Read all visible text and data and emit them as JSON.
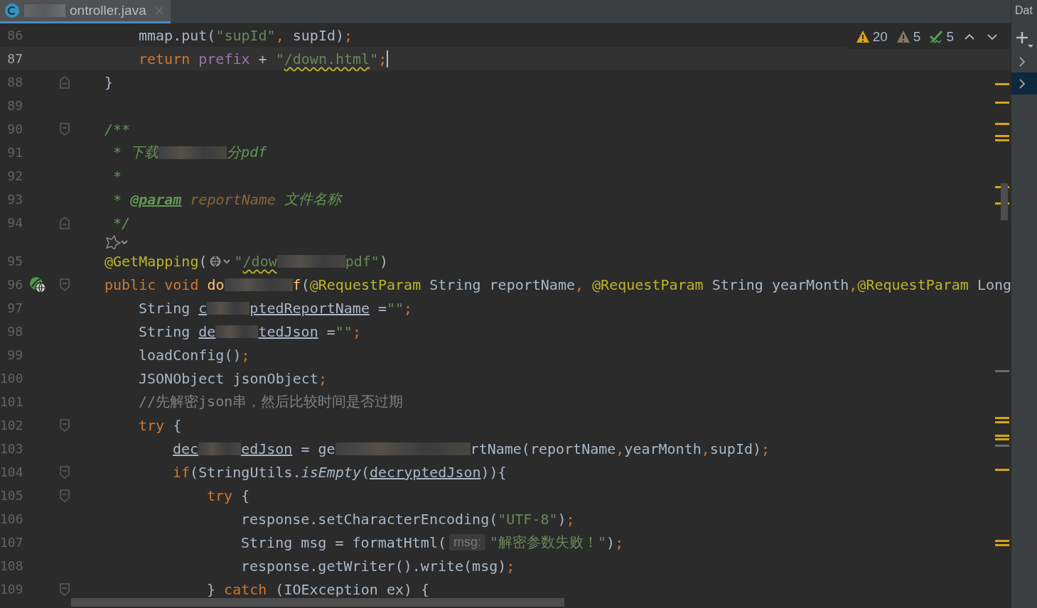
{
  "tab": {
    "file_name": "ontroller.java",
    "selected": true
  },
  "inspections": [
    {
      "kind": "warning",
      "count": "20"
    },
    {
      "kind": "weak_warning",
      "count": "5"
    },
    {
      "kind": "typo",
      "count": "5"
    }
  ],
  "lines": [
    {
      "kind": "code",
      "number": "86",
      "current": false,
      "tokens": [
        {
          "kind": "indent_2"
        },
        {
          "kind": "plain",
          "text": "mmap.put("
        },
        {
          "kind": "string",
          "text": "\"supId\""
        },
        {
          "kind": "punct",
          "text": ","
        },
        {
          "kind": "plain",
          "text": " supId)"
        },
        {
          "kind": "punct",
          "text": ";"
        }
      ]
    },
    {
      "kind": "code",
      "number": "87",
      "current": true,
      "tokens": [
        {
          "kind": "indent_2"
        },
        {
          "kind": "keyword",
          "text": "return"
        },
        {
          "kind": "field",
          "text": " prefix"
        },
        {
          "kind": "plain",
          "text": " + "
        },
        {
          "kind": "string",
          "text": "\""
        },
        {
          "kind": "string_warn",
          "text": "/down.html"
        },
        {
          "kind": "string",
          "text": "\""
        },
        {
          "kind": "punct",
          "text": ";"
        },
        {
          "kind": "caret"
        }
      ]
    },
    {
      "kind": "code",
      "number": "88",
      "current": false,
      "gutter": [
        {
          "kind": "fold_end"
        }
      ],
      "tokens": [
        {
          "kind": "indent_1"
        },
        {
          "kind": "plain",
          "text": "}"
        }
      ]
    },
    {
      "kind": "code",
      "number": "89",
      "current": false
    },
    {
      "kind": "code",
      "number": "90",
      "current": false,
      "gutter": [
        {
          "kind": "fold_start"
        }
      ],
      "tokens": [
        {
          "kind": "indent_1"
        },
        {
          "kind": "doc",
          "text": "/**"
        }
      ]
    },
    {
      "kind": "code",
      "number": "91",
      "current": false,
      "tokens": [
        {
          "kind": "indent_1"
        },
        {
          "kind": "doc",
          "text": " * 下载"
        },
        {
          "kind": "redacted_l"
        },
        {
          "kind": "doc",
          "text": "分pdf"
        }
      ]
    },
    {
      "kind": "code",
      "number": "92",
      "current": false,
      "tokens": [
        {
          "kind": "indent_1"
        },
        {
          "kind": "doc",
          "text": " *"
        }
      ]
    },
    {
      "kind": "code",
      "number": "93",
      "current": false,
      "tokens": [
        {
          "kind": "indent_1"
        },
        {
          "kind": "doc",
          "text": " * "
        },
        {
          "kind": "doc_tag",
          "text": "@param"
        },
        {
          "kind": "doc_param",
          "text": " reportName"
        },
        {
          "kind": "doc",
          "text": " 文件名称"
        }
      ]
    },
    {
      "kind": "code",
      "number": "94",
      "current": false,
      "gutter": [
        {
          "kind": "fold_end"
        }
      ],
      "tokens": [
        {
          "kind": "indent_1"
        },
        {
          "kind": "doc",
          "text": " */"
        }
      ]
    },
    {
      "kind": "inlay"
    },
    {
      "kind": "code",
      "number": "95",
      "current": false,
      "tokens": [
        {
          "kind": "indent_1"
        },
        {
          "kind": "annotation",
          "text": "@GetMapping"
        },
        {
          "kind": "plain",
          "text": "("
        },
        {
          "kind": "globe_hint"
        },
        {
          "kind": "string",
          "text": "\""
        },
        {
          "kind": "string_warn",
          "text": "/dow"
        },
        {
          "kind": "redacted_l"
        },
        {
          "kind": "string",
          "text": "pdf\""
        },
        {
          "kind": "plain",
          "text": ")"
        }
      ]
    },
    {
      "kind": "code",
      "number": "96",
      "current": false,
      "gutter": [
        {
          "kind": "endpoint_icon"
        },
        {
          "kind": "fold_start"
        }
      ],
      "tokens": [
        {
          "kind": "indent_1"
        },
        {
          "kind": "keyword",
          "text": "public void"
        },
        {
          "kind": "method",
          "text": " do"
        },
        {
          "kind": "redacted_l"
        },
        {
          "kind": "method",
          "text": "f"
        },
        {
          "kind": "plain",
          "text": "("
        },
        {
          "kind": "annotation",
          "text": "@RequestParam"
        },
        {
          "kind": "plain",
          "text": " String reportName"
        },
        {
          "kind": "punct",
          "text": ","
        },
        {
          "kind": "annotation",
          "text": " @RequestParam"
        },
        {
          "kind": "plain",
          "text": " String yearMonth"
        },
        {
          "kind": "punct",
          "text": ","
        },
        {
          "kind": "annotation",
          "text": "@RequestParam"
        },
        {
          "kind": "plain",
          "text": " Long"
        }
      ]
    },
    {
      "kind": "code",
      "number": "97",
      "current": false,
      "tokens": [
        {
          "kind": "indent_2"
        },
        {
          "kind": "plain",
          "text": "String "
        },
        {
          "kind": "var_ref",
          "text": "c"
        },
        {
          "kind": "redacted_m"
        },
        {
          "kind": "var_ref",
          "text": "ptedReportName"
        },
        {
          "kind": "plain",
          "text": " ="
        },
        {
          "kind": "string",
          "text": "\"\""
        },
        {
          "kind": "punct",
          "text": ";"
        }
      ]
    },
    {
      "kind": "code",
      "number": "98",
      "current": false,
      "tokens": [
        {
          "kind": "indent_2"
        },
        {
          "kind": "plain",
          "text": "String "
        },
        {
          "kind": "var_ref",
          "text": "de"
        },
        {
          "kind": "redacted_m"
        },
        {
          "kind": "var_ref",
          "text": "tedJson"
        },
        {
          "kind": "plain",
          "text": " ="
        },
        {
          "kind": "string",
          "text": "\"\""
        },
        {
          "kind": "punct",
          "text": ";"
        }
      ]
    },
    {
      "kind": "code",
      "number": "99",
      "current": false,
      "tokens": [
        {
          "kind": "indent_2"
        },
        {
          "kind": "plain",
          "text": "loadConfig()"
        },
        {
          "kind": "punct",
          "text": ";"
        }
      ]
    },
    {
      "kind": "code",
      "number": "100",
      "current": false,
      "tokens": [
        {
          "kind": "indent_2"
        },
        {
          "kind": "plain",
          "text": "JSONObject jsonObject"
        },
        {
          "kind": "punct",
          "text": ";"
        }
      ]
    },
    {
      "kind": "code",
      "number": "101",
      "current": false,
      "tokens": [
        {
          "kind": "indent_2"
        },
        {
          "kind": "comment",
          "text": "//先解密json串，然后比较时间是否过期"
        }
      ]
    },
    {
      "kind": "code",
      "number": "102",
      "current": false,
      "gutter": [
        {
          "kind": "fold_start"
        }
      ],
      "tokens": [
        {
          "kind": "indent_2"
        },
        {
          "kind": "keyword",
          "text": "try"
        },
        {
          "kind": "plain",
          "text": " {"
        }
      ]
    },
    {
      "kind": "code",
      "number": "103",
      "current": false,
      "tokens": [
        {
          "kind": "indent_3"
        },
        {
          "kind": "var_ref",
          "text": "dec"
        },
        {
          "kind": "redacted_m"
        },
        {
          "kind": "var_ref",
          "text": "edJson"
        },
        {
          "kind": "plain",
          "text": " = ge"
        },
        {
          "kind": "redacted_xl"
        },
        {
          "kind": "plain",
          "text": "rtName(reportName"
        },
        {
          "kind": "punct",
          "text": ","
        },
        {
          "kind": "plain",
          "text": "yearMonth"
        },
        {
          "kind": "punct",
          "text": ","
        },
        {
          "kind": "plain",
          "text": "supId)"
        },
        {
          "kind": "punct",
          "text": ";"
        }
      ]
    },
    {
      "kind": "code",
      "number": "104",
      "current": false,
      "gutter": [
        {
          "kind": "fold_start"
        }
      ],
      "tokens": [
        {
          "kind": "indent_3"
        },
        {
          "kind": "keyword",
          "text": "if"
        },
        {
          "kind": "plain",
          "text": "(StringUtils."
        },
        {
          "kind": "static_call",
          "text": "isEmpty"
        },
        {
          "kind": "plain",
          "text": "("
        },
        {
          "kind": "var_ref",
          "text": "decryptedJson"
        },
        {
          "kind": "plain",
          "text": ")){"
        }
      ]
    },
    {
      "kind": "code",
      "number": "105",
      "current": false,
      "gutter": [
        {
          "kind": "fold_start"
        }
      ],
      "tokens": [
        {
          "kind": "indent_4"
        },
        {
          "kind": "keyword",
          "text": "try"
        },
        {
          "kind": "plain",
          "text": " {"
        }
      ]
    },
    {
      "kind": "code",
      "number": "106",
      "current": false,
      "tokens": [
        {
          "kind": "indent_5"
        },
        {
          "kind": "plain",
          "text": "response.setCharacterEncoding("
        },
        {
          "kind": "string",
          "text": "\"UTF-8\""
        },
        {
          "kind": "plain",
          "text": ")"
        },
        {
          "kind": "punct",
          "text": ";"
        }
      ]
    },
    {
      "kind": "code",
      "number": "107",
      "current": false,
      "tokens": [
        {
          "kind": "indent_5"
        },
        {
          "kind": "plain",
          "text": "String msg = formatHtml("
        },
        {
          "kind": "hint",
          "text": "msg:"
        },
        {
          "kind": "string",
          "text": "\"解密参数失败！\""
        },
        {
          "kind": "plain",
          "text": ")"
        },
        {
          "kind": "punct",
          "text": ";"
        }
      ]
    },
    {
      "kind": "code",
      "number": "108",
      "current": false,
      "tokens": [
        {
          "kind": "indent_5"
        },
        {
          "kind": "plain",
          "text": "response.getWriter().write(msg)"
        },
        {
          "kind": "punct",
          "text": ";"
        }
      ]
    },
    {
      "kind": "code",
      "number": "109",
      "current": false,
      "gutter": [
        {
          "kind": "fold_start"
        }
      ],
      "tokens": [
        {
          "kind": "indent_4"
        },
        {
          "kind": "plain",
          "text": "} "
        },
        {
          "kind": "keyword",
          "text": "catch"
        },
        {
          "kind": "plain",
          "text": " (IOException ex) {"
        }
      ]
    }
  ],
  "side_panel": {
    "title": "Dat",
    "rows": [
      {
        "selected": false
      },
      {
        "selected": true
      }
    ]
  }
}
